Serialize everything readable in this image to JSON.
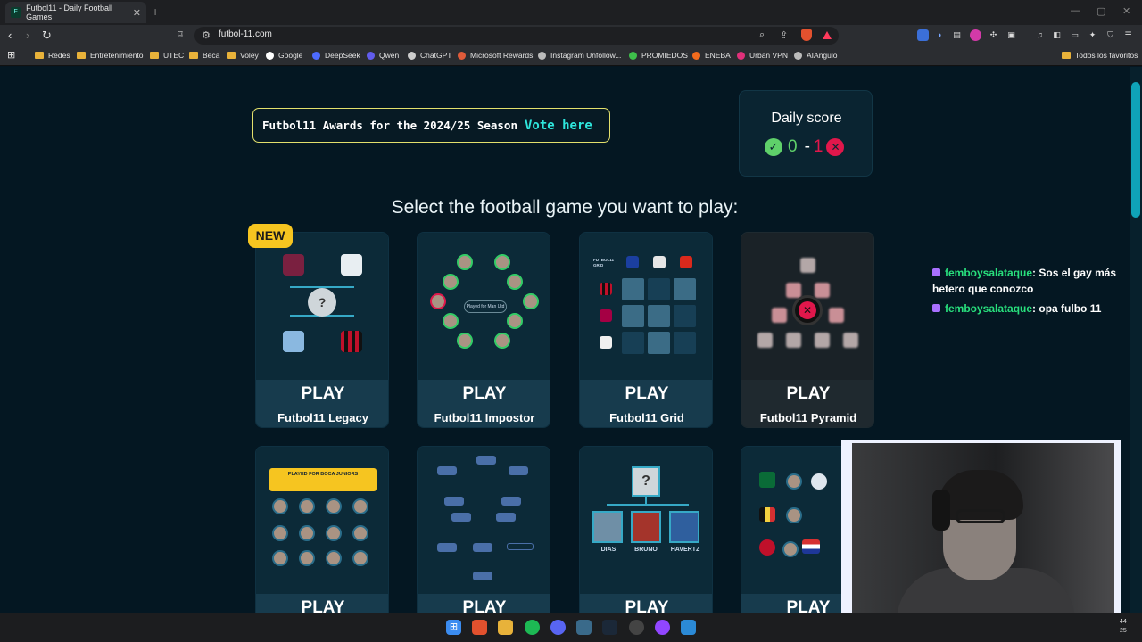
{
  "browser": {
    "tab_title": "Futbol11 - Daily Football Games",
    "tab_close": "✕",
    "new_tab": "+",
    "url": "futbol-11.com",
    "bookmarks": [
      {
        "label": "Redes",
        "type": "folder"
      },
      {
        "label": "Entretenimiento",
        "type": "folder"
      },
      {
        "label": "UTEC",
        "type": "folder"
      },
      {
        "label": "Beca",
        "type": "folder"
      },
      {
        "label": "Voley",
        "type": "folder"
      },
      {
        "label": "Google",
        "type": "site"
      },
      {
        "label": "DeepSeek",
        "type": "site"
      },
      {
        "label": "Qwen",
        "type": "site"
      },
      {
        "label": "ChatGPT",
        "type": "site"
      },
      {
        "label": "Microsoft Rewards",
        "type": "site"
      },
      {
        "label": "Instagram Unfollow...",
        "type": "site"
      },
      {
        "label": "PROMIEDOS",
        "type": "site"
      },
      {
        "label": "ENEBA",
        "type": "site"
      },
      {
        "label": "Urban VPN",
        "type": "site"
      },
      {
        "label": "AIAngulo",
        "type": "site"
      }
    ],
    "all_bookmarks": "Todos los favoritos"
  },
  "awards": {
    "text": "Futbol11 Awards for the 2024/25 Season",
    "link": "Vote here"
  },
  "daily_score": {
    "title": "Daily score",
    "correct": "0",
    "separator": "-",
    "wrong": "1"
  },
  "select_title": "Select the football game you want to play:",
  "new_badge": "NEW",
  "games": [
    {
      "play": "PLAY",
      "name": "Futbol11 Legacy"
    },
    {
      "play": "PLAY",
      "name": "Futbol11 Impostor"
    },
    {
      "play": "PLAY",
      "name": "Futbol11 Grid"
    },
    {
      "play": "PLAY",
      "name": "Futbol11 Pyramid"
    },
    {
      "play": "PLAY",
      "name": ""
    },
    {
      "play": "PLAY",
      "name": ""
    },
    {
      "play": "PLAY",
      "name": ""
    },
    {
      "play": "PLAY",
      "name": ""
    }
  ],
  "thumb_text": {
    "grid_logo": "FUTBOL11 GRID",
    "boca_title": "PLAYED FOR BOCA JUNIORS",
    "impostor_center": "Played for Man Utd",
    "legacy_question": "?",
    "tree_players": [
      "DIAS",
      "BRUNO",
      "HAVERTZ"
    ]
  },
  "chat": [
    {
      "user": "femboysalataque",
      "message": ": Sos el gay más hetero que conozco"
    },
    {
      "user": "femboysalataque",
      "message": ": opa fulbo 11"
    }
  ],
  "clock": {
    "line1": "44",
    "line2": "25"
  },
  "colors": {
    "page_bg": "#041722",
    "accent": "#2ee6dc",
    "correct": "#5fd06a",
    "wrong": "#e0174b",
    "badge": "#f6c520"
  }
}
